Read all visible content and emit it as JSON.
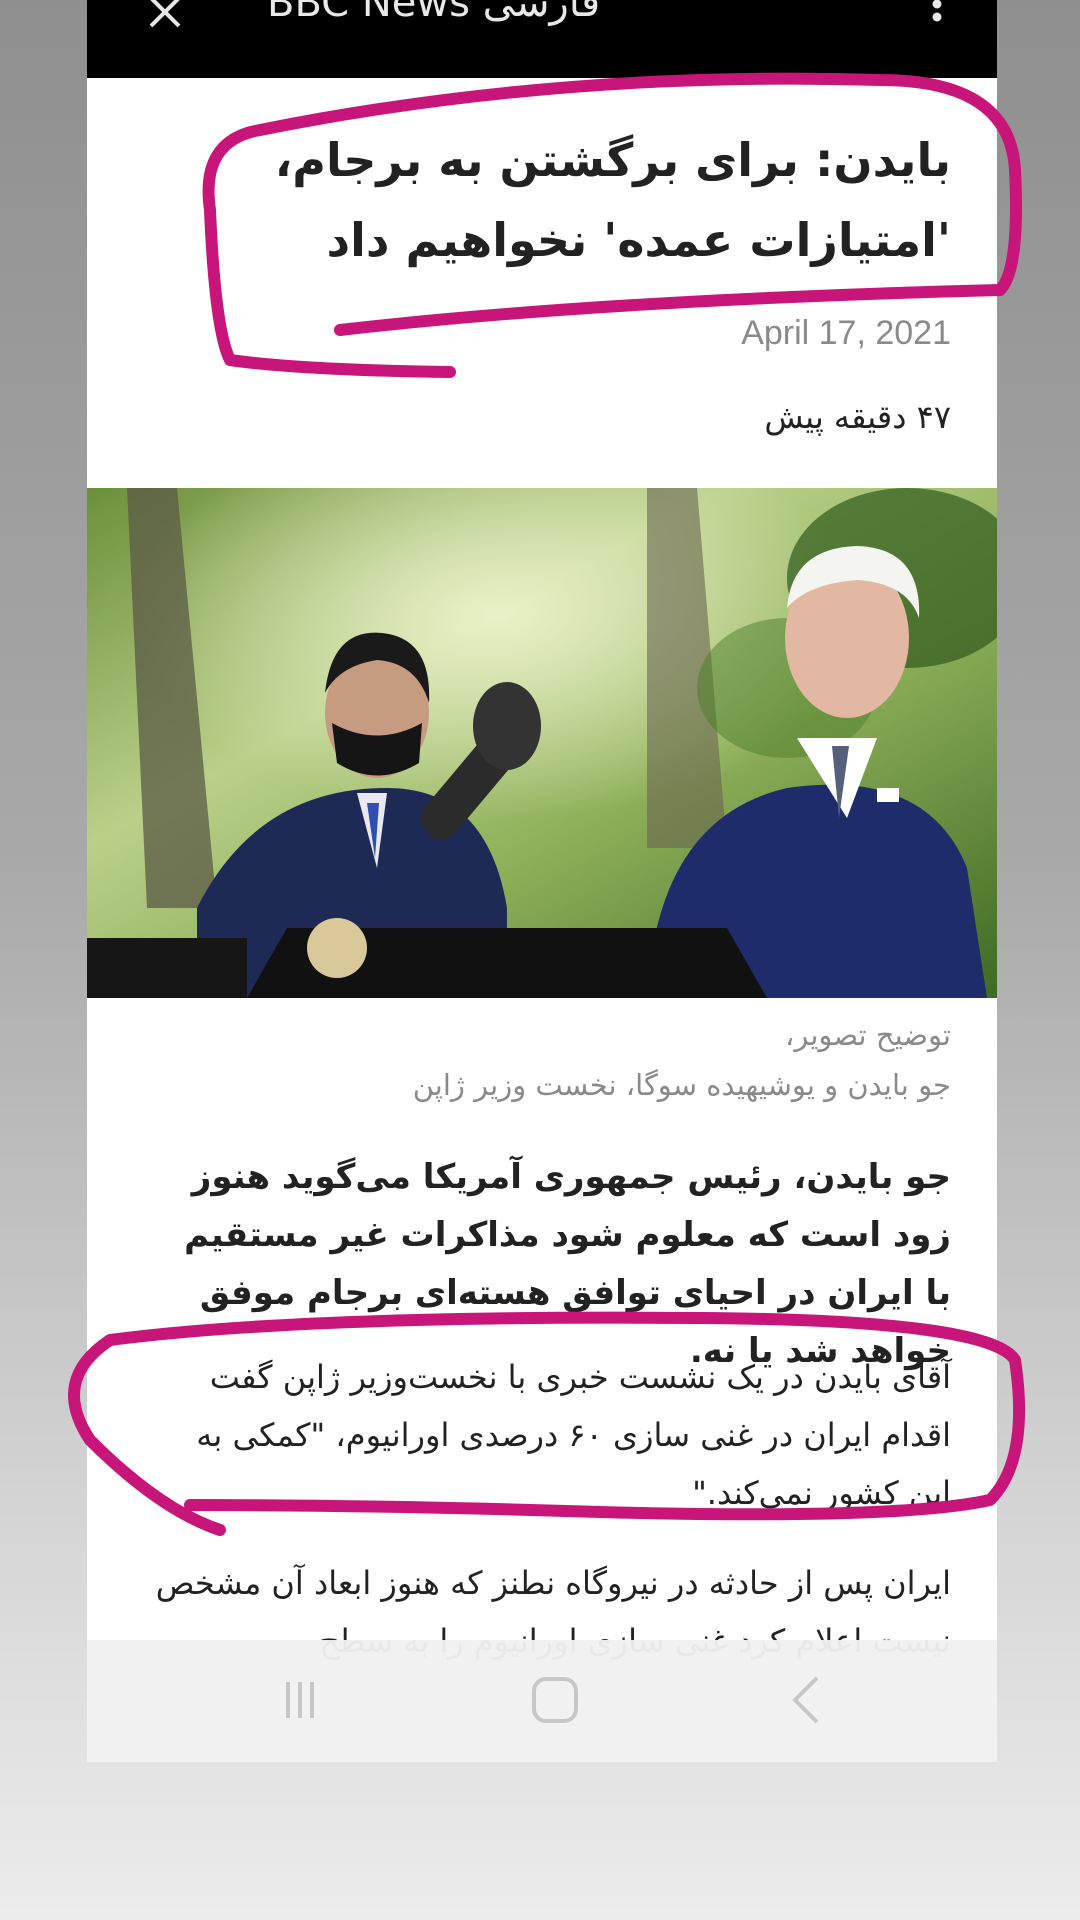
{
  "appbar": {
    "title": "BBC News فارسی",
    "close_icon": "close-icon",
    "menu_icon": "more-vertical-icon"
  },
  "article": {
    "headline_line1": "بایدن: برای برگشتن به برجام،",
    "headline_line2": "'امتیازات عمده' نخواهیم داد",
    "date": "April 17, 2021",
    "time_ago": "۴۷ دقیقه پیش",
    "caption_label": "توضیح تصویر،",
    "caption_text": "جو بایدن و یوشیهیده سوگا، نخست وزیر ژاپن",
    "lead": "جو بایدن، رئیس جمهوری آمریکا می‌گوید هنوز زود است که معلوم شود مذاکرات غیر مستقیم با ایران در احیای توافق هسته‌ای برجام موفق خواهد شد یا نه.",
    "paragraph1": "آقای بایدن در یک نشست خبری با نخست‌وزیر ژاپن گفت اقدام ایران در غنی سازی ۶۰ درصدی اورانیوم، \"کمکی به این کشور نمی‌کند.\"",
    "paragraph2": "ایران پس از حادثه در نیروگاه نطنز که هنوز ابعاد آن مشخص نیست اعلام کرد غنی سازی اورانیوم را به سطح"
  },
  "navbar": {
    "recents_icon": "recents-icon",
    "home_icon": "home-icon",
    "back_icon": "back-icon"
  },
  "colors": {
    "annotation": "#c8157a",
    "text": "#222222",
    "muted": "#8a8a8a"
  }
}
